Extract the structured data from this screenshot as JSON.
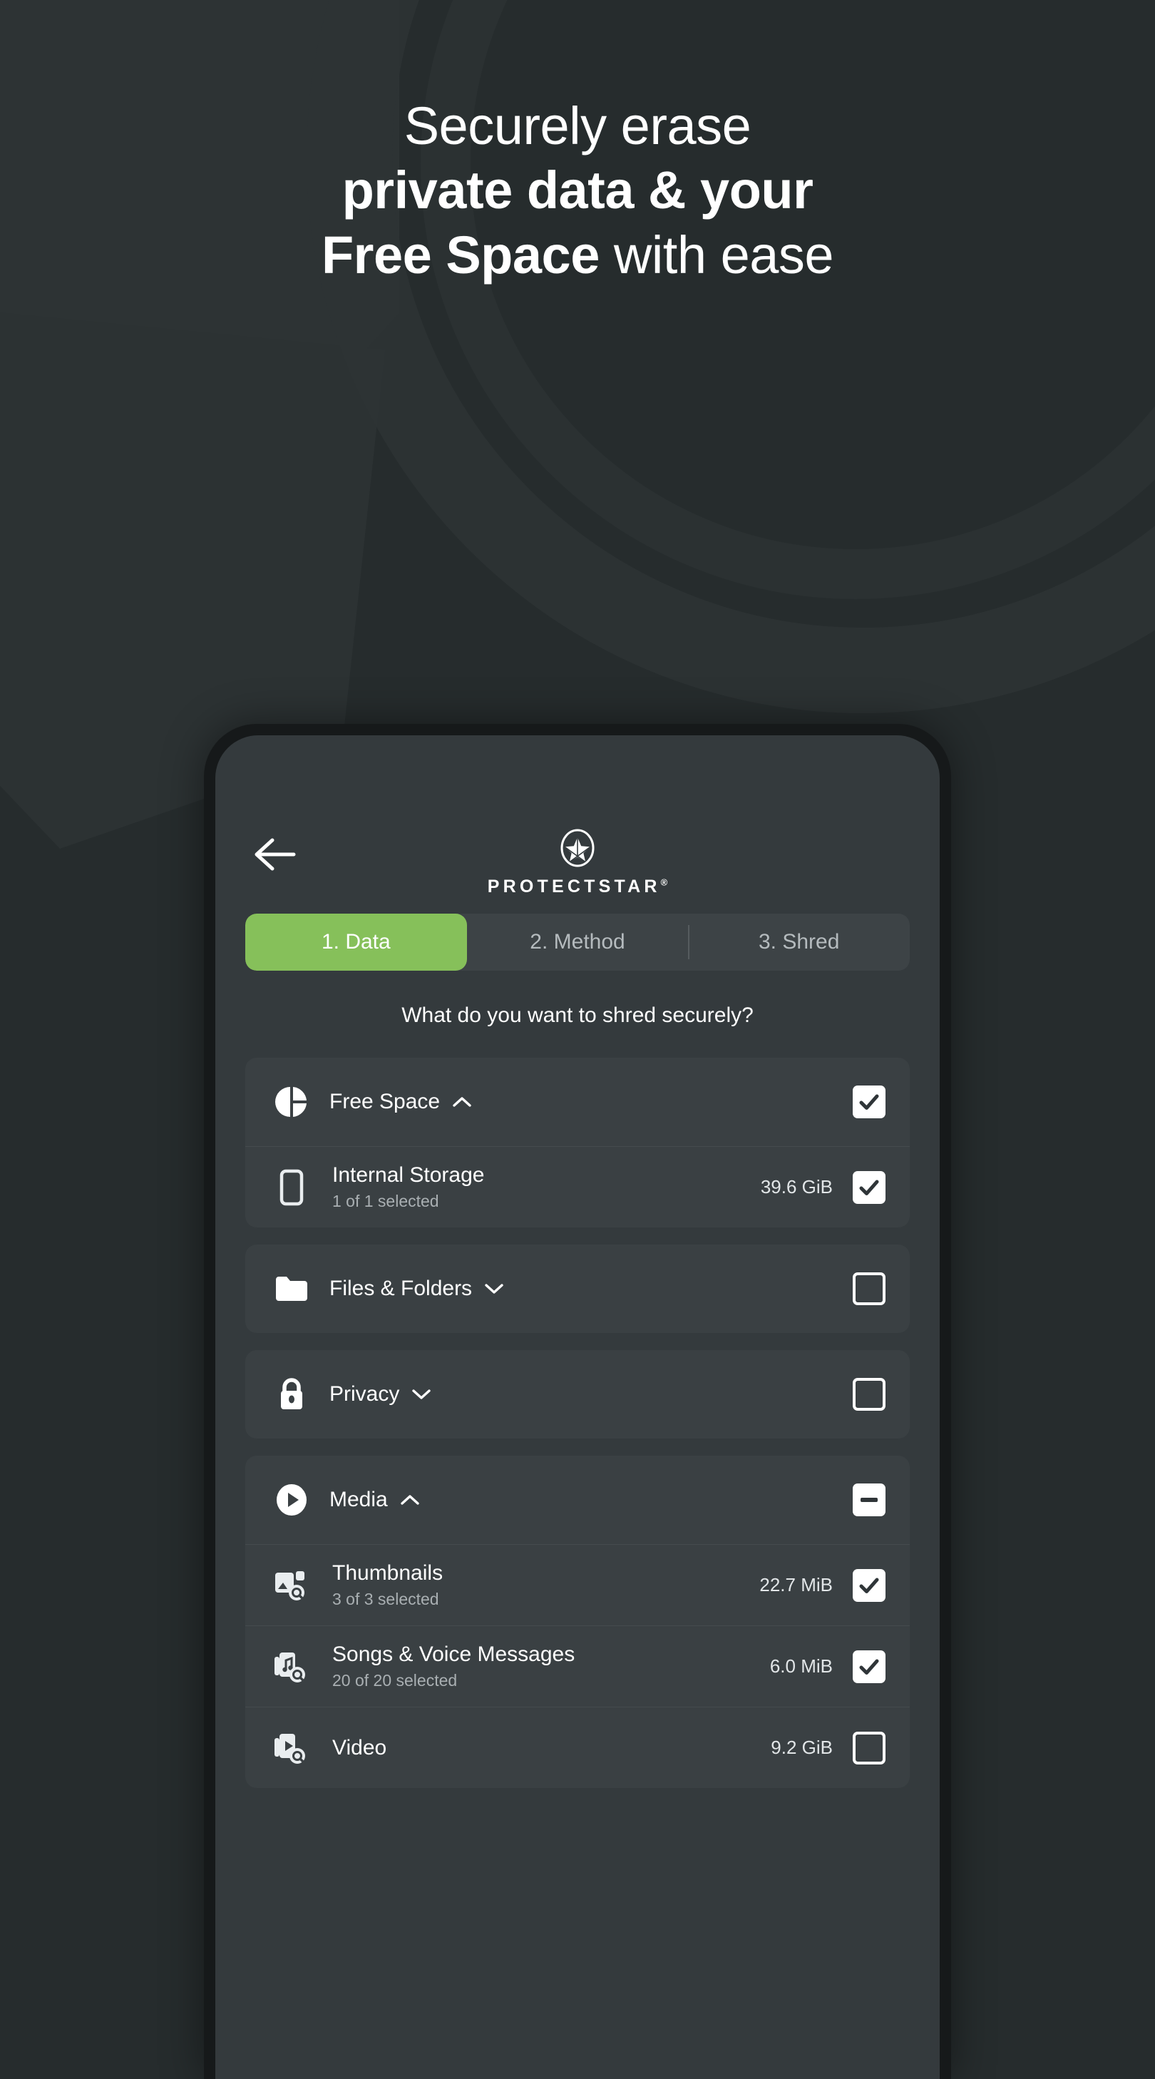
{
  "headline": {
    "line1": "Securely erase",
    "line2": "private data & your",
    "line3_bold": "Free Space",
    "line3_light": " with ease"
  },
  "colors": {
    "accent_green": "#86c05a",
    "page_background": "#262c2d",
    "screen_background": "#343a3d",
    "card_background": "#3a4043",
    "phone_bezel": "#16191a"
  },
  "app": {
    "back_icon": "arrow-left-icon",
    "brand_mark_icon": "protectstar-star-logo",
    "brand_name": "PROTECTSTAR",
    "brand_registered": "®",
    "tabs": [
      {
        "label": "1. Data",
        "active": true
      },
      {
        "label": "2. Method",
        "active": false
      },
      {
        "label": "3. Shred",
        "active": false
      }
    ],
    "question": "What do you want to shred securely?",
    "cards": [
      {
        "name": "free-space",
        "head": {
          "icon": "pie-chart-icon",
          "title": "Free Space",
          "chevron": "chevron-up-icon",
          "checkbox": "checked",
          "size": ""
        },
        "rows": [
          {
            "name": "internal-storage",
            "icon": "phone-icon",
            "title": "Internal Storage",
            "subtitle": "1 of 1 selected",
            "size": "39.6 GiB",
            "checkbox": "checked"
          }
        ]
      },
      {
        "name": "files-and-folders",
        "head": {
          "icon": "folder-icon",
          "title": "Files & Folders",
          "chevron": "chevron-down-icon",
          "checkbox": "unchecked",
          "size": ""
        },
        "rows": []
      },
      {
        "name": "privacy",
        "head": {
          "icon": "lock-icon",
          "title": "Privacy",
          "chevron": "chevron-down-icon",
          "checkbox": "unchecked",
          "size": ""
        },
        "rows": []
      },
      {
        "name": "media",
        "head": {
          "icon": "play-circle-icon",
          "title": "Media",
          "chevron": "chevron-up-icon",
          "checkbox": "indeterminate",
          "size": ""
        },
        "rows": [
          {
            "name": "thumbnails",
            "icon": "image-search-icon",
            "title": "Thumbnails",
            "subtitle": "3 of 3 selected",
            "size": "22.7 MiB",
            "checkbox": "checked"
          },
          {
            "name": "songs-and-voice-messages",
            "icon": "music-search-icon",
            "title": "Songs & Voice Messages",
            "subtitle": "20 of 20 selected",
            "size": "6.0 MiB",
            "checkbox": "checked"
          },
          {
            "name": "video",
            "icon": "video-search-icon",
            "title": "Video",
            "subtitle": "",
            "size": "9.2 GiB",
            "checkbox": "unchecked"
          }
        ]
      }
    ]
  }
}
